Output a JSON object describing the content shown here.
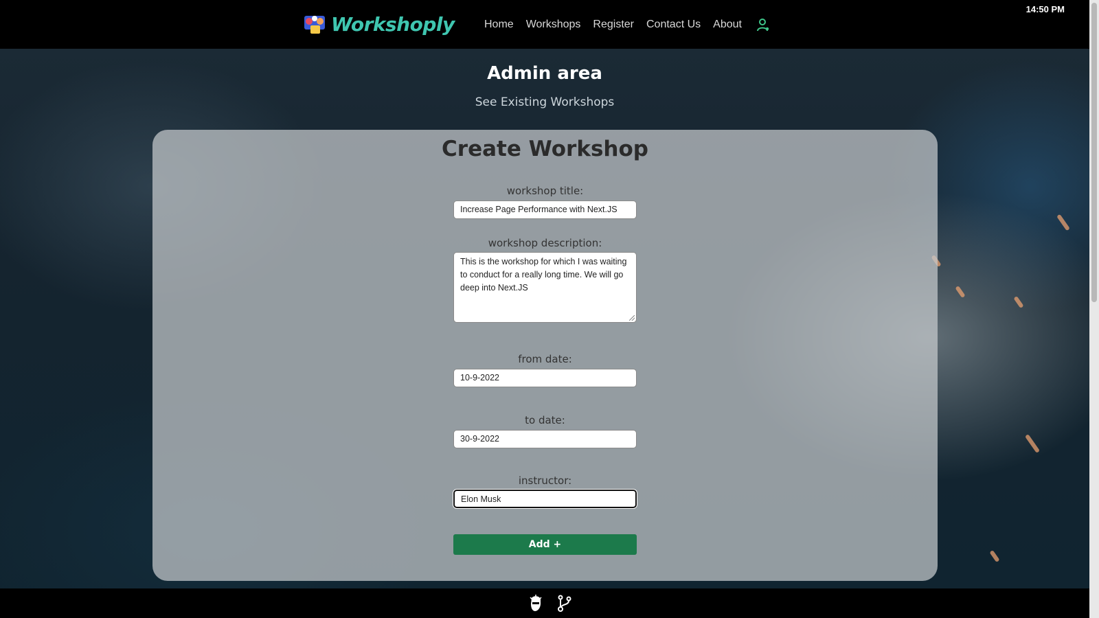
{
  "header": {
    "brand": "Workshoply",
    "nav": [
      "Home",
      "Workshops",
      "Register",
      "Contact Us",
      "About"
    ],
    "clock": "14:50 PM"
  },
  "admin": {
    "title": "Admin area",
    "see_link": "See Existing Workshops"
  },
  "form": {
    "title": "Create Workshop",
    "fields": {
      "title": {
        "label": "workshop title:",
        "value": "Increase Page Performance with Next.JS"
      },
      "description": {
        "label": "workshop description:",
        "value": "This is the workshop for which I was waiting to conduct for a really long time. We will go deep into Next.JS"
      },
      "from_date": {
        "label": "from date:",
        "value": "10-9-2022"
      },
      "to_date": {
        "label": "to date:",
        "value": "30-9-2022"
      },
      "instructor": {
        "label": "instructor:",
        "value": "Elon Musk"
      }
    },
    "submit_label": "Add +"
  },
  "footer": {
    "icons": [
      "avatar-icon",
      "git-branch-icon"
    ]
  },
  "colors": {
    "brand": "#3fc6b0",
    "accent_button": "#1c7a4b",
    "nav_bg": "#000000"
  }
}
